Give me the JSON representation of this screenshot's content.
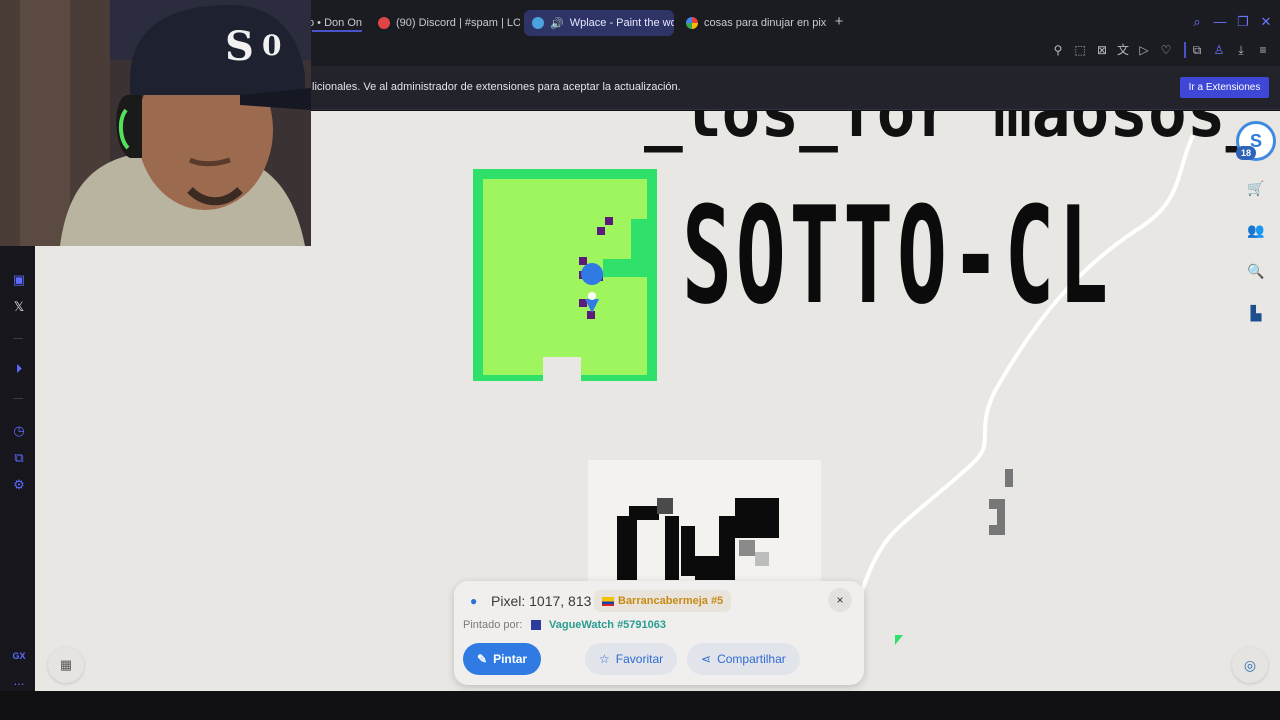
{
  "tabs": [
    {
      "label": "o • Don On",
      "color": "#d3d3d3",
      "active": false
    },
    {
      "label": "(90) Discord | #spam | LO",
      "color": "#5865f2",
      "active": false
    },
    {
      "label": "Wplace - Paint the wo",
      "color": "#4aa3df",
      "active": true
    },
    {
      "label": "cosas para dinujar en pix",
      "color": "#ea4335",
      "active": false
    }
  ],
  "new_tab_label": "+",
  "notification": {
    "message": "licionales. Ve al administrador de extensiones para aceptar la actualización.",
    "button_label": "Ir a Extensiones"
  },
  "sidebar": {
    "items": [
      "twitch-icon",
      "x-icon",
      "player-icon",
      "history-icon",
      "extensions-icon",
      "settings-icon"
    ],
    "bottom_label": "GX",
    "more_label": "..."
  },
  "canvas": {
    "big_text": "SOTTO-CL",
    "top_text": "_los_for maosos_",
    "avatar_initial": "S",
    "avatar_badge": "18"
  },
  "pixel_card": {
    "title": "Pixel: 1017, 813",
    "region": "Barrancabermeja #5",
    "painted_by_label": "Pintado por:",
    "user": "VagueWatch",
    "user_id": "#5791063",
    "close_label": "×",
    "paint_label": "Pintar",
    "favorite_label": "Favoritar",
    "share_label": "Compartilhar"
  },
  "colors": {
    "accent": "#2f7be3",
    "pixel_green": "#9ef55e",
    "pixel_border": "#2fe06b",
    "purple": "#5c1a7a",
    "region_text": "#c98a14",
    "user_text": "#2a9d8f"
  }
}
